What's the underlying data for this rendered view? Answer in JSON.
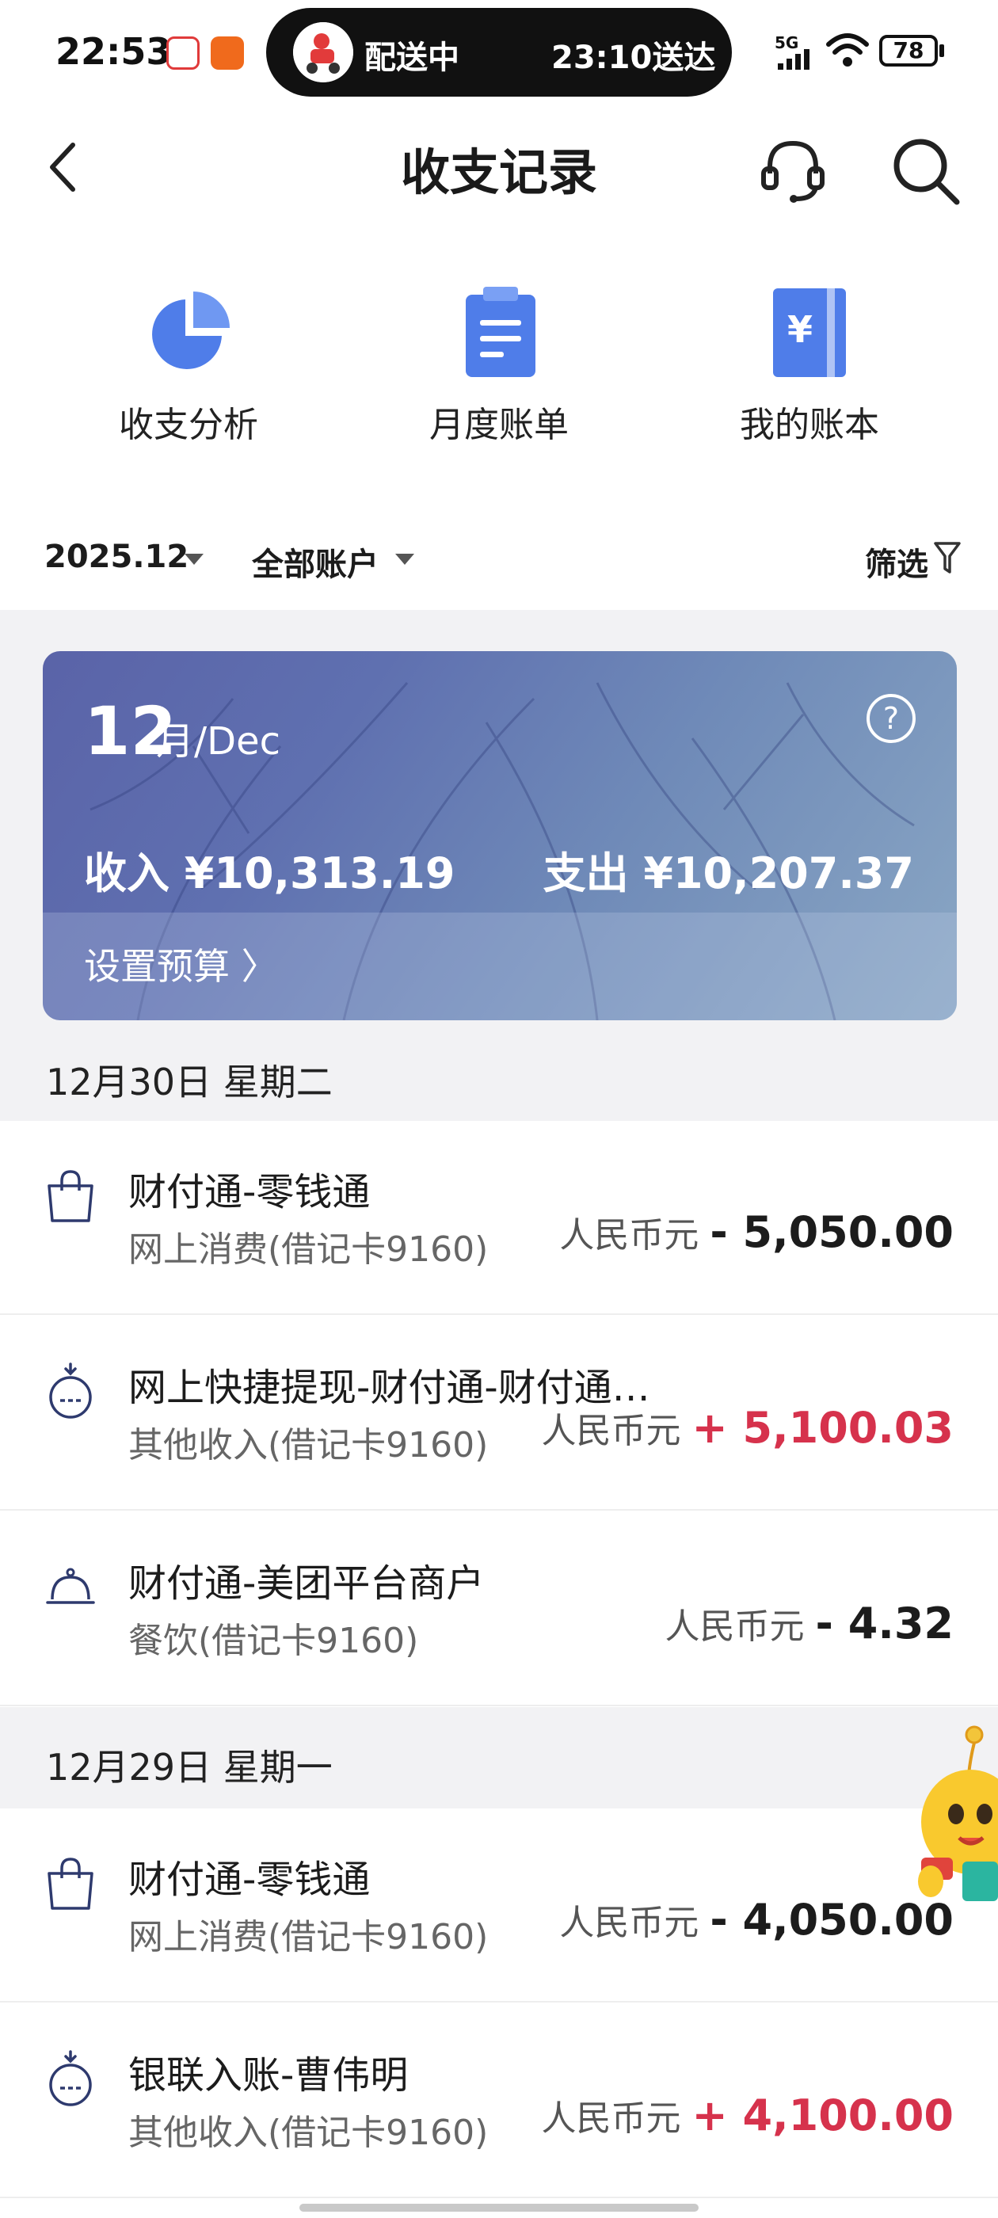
{
  "status_bar": {
    "time": "22:53",
    "network": "5G",
    "battery": "78"
  },
  "live_activity": {
    "left_text": "配送中",
    "right_text": "23:10送达"
  },
  "nav": {
    "title": "收支记录"
  },
  "quick_actions": [
    {
      "label": "收支分析",
      "icon": "pie-chart-icon"
    },
    {
      "label": "月度账单",
      "icon": "bill-icon"
    },
    {
      "label": "我的账本",
      "icon": "ledger-icon"
    }
  ],
  "filters": {
    "month": "2025.12",
    "account": "全部账户",
    "filter_label": "筛选"
  },
  "banner": {
    "day": "12",
    "month_suffix": "月/Dec",
    "income": "收入 ¥10,313.19",
    "expense": "支出 ¥10,207.37",
    "budget_link": "设置预算 〉"
  },
  "groups": [
    {
      "date": "12月30日 星期二",
      "items": [
        {
          "title": "财付通-零钱通",
          "subtitle": "网上消费(借记卡9160)",
          "currency": "人民币元",
          "amount": "- 5,050.00",
          "type": "neg",
          "icon": "shopping-bag-icon"
        },
        {
          "title": "网上快捷提现-财付通-财付通…",
          "subtitle": "其他收入(借记卡9160)",
          "currency": "人民币元",
          "amount": "+ 5,100.03",
          "type": "pos",
          "icon": "money-bag-icon"
        },
        {
          "title": "财付通-美团平台商户",
          "subtitle": "餐饮(借记卡9160)",
          "currency": "人民币元",
          "amount": "- 4.32",
          "type": "neg",
          "icon": "dining-cloche-icon"
        }
      ]
    },
    {
      "date": "12月29日 星期一",
      "items": [
        {
          "title": "财付通-零钱通",
          "subtitle": "网上消费(借记卡9160)",
          "currency": "人民币元",
          "amount": "- 4,050.00",
          "type": "neg",
          "icon": "shopping-bag-icon"
        },
        {
          "title": "银联入账-曹伟明",
          "subtitle": "其他收入(借记卡9160)",
          "currency": "人民币元",
          "amount": "+ 4,100.00",
          "type": "pos",
          "icon": "money-bag-icon"
        }
      ]
    }
  ]
}
